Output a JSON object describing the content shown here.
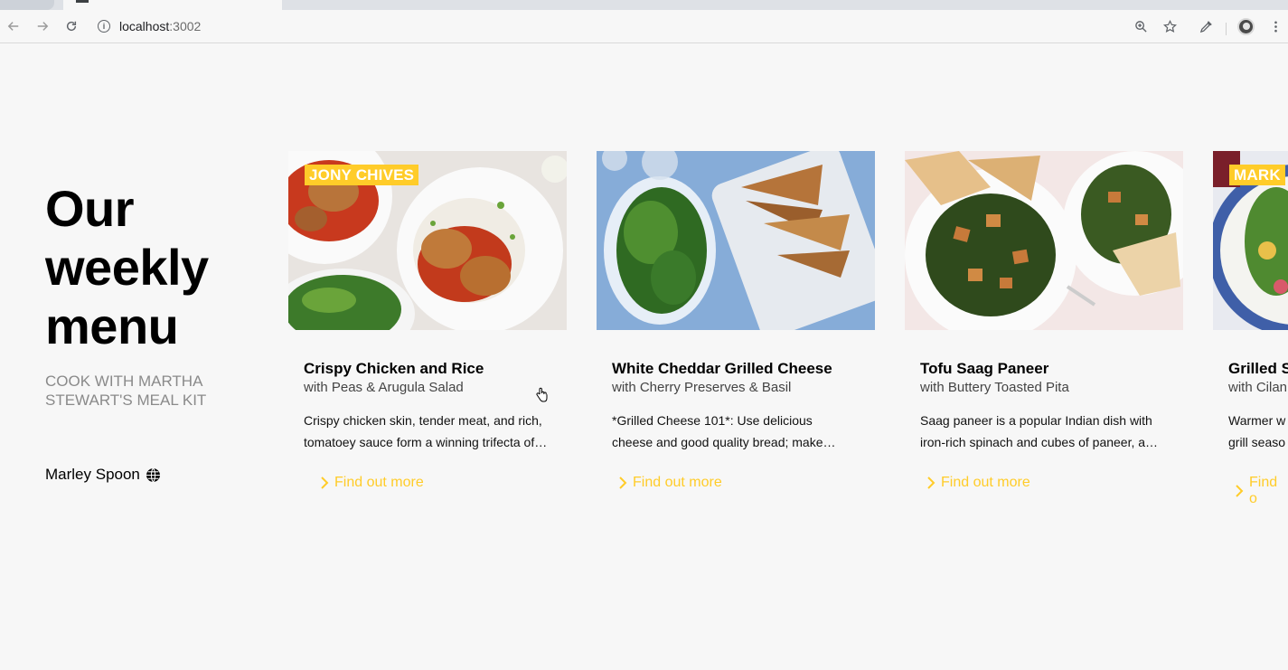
{
  "browser": {
    "url_host": "localhost",
    "url_port": ":3002"
  },
  "hero": {
    "title_lines": [
      "Our",
      "weekly",
      "menu"
    ],
    "subtitle": "COOK WITH MARTHA STEWART'S MEAL KIT",
    "brand": "Marley Spoon"
  },
  "cards": [
    {
      "tag": "JONY CHIVES",
      "title": "Crispy Chicken and Rice",
      "subtitle": "with Peas & Arugula Salad",
      "desc_line1": "Crispy chicken skin, tender meat, and rich,",
      "desc_line2": "tomatoey sauce form a winning trifecta of…",
      "link": "Find out more"
    },
    {
      "tag": "",
      "title": "White Cheddar Grilled Cheese",
      "subtitle": "with Cherry Preserves & Basil",
      "desc_line1": "*Grilled Cheese 101*: Use delicious",
      "desc_line2": "cheese and good quality bread; make…",
      "link": "Find out more"
    },
    {
      "tag": "",
      "title": "Tofu Saag Paneer",
      "subtitle": "with Buttery Toasted Pita",
      "desc_line1": "Saag paneer is a popular Indian dish with",
      "desc_line2": "iron-rich spinach and cubes of paneer, a…",
      "link": "Find out more"
    },
    {
      "tag": "MARK",
      "title": "Grilled S",
      "subtitle": "with Cilan",
      "desc_line1": "Warmer w",
      "desc_line2": "grill seaso",
      "link": "Find o"
    }
  ],
  "colors": {
    "accent": "#ffcc29",
    "page_bg": "#f7f7f7"
  }
}
